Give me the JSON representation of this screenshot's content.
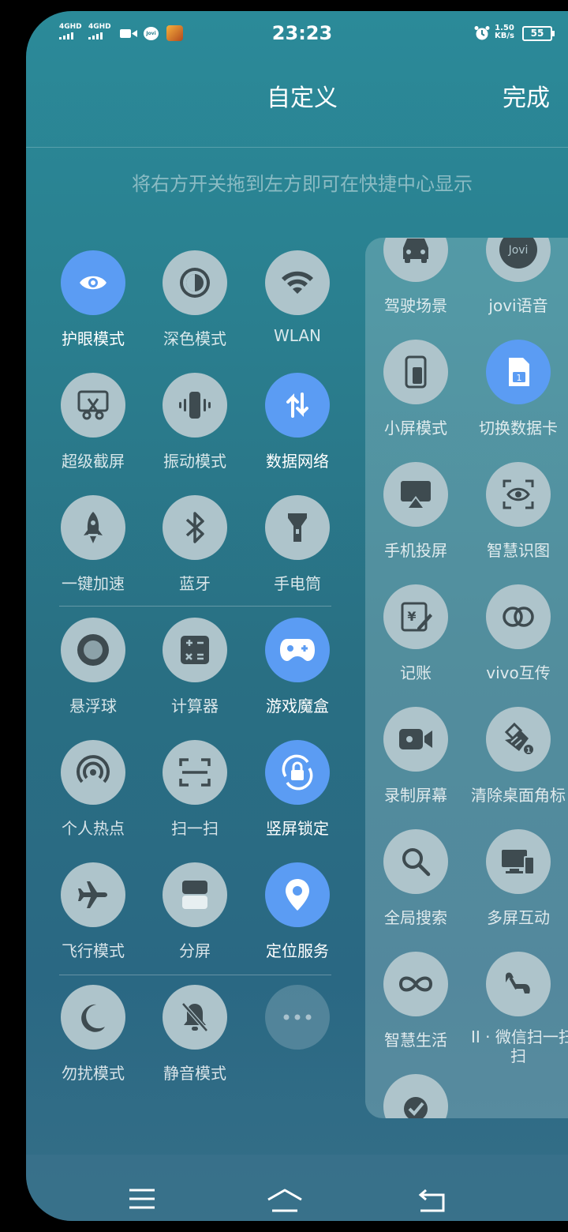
{
  "status": {
    "signal1": "4GHD",
    "signal2": "4GHD",
    "jovi_badge": "Jovi",
    "time": "23:23",
    "speed_value": "1.50",
    "speed_unit": "KB/s",
    "battery": "55"
  },
  "header": {
    "title": "自定义",
    "done": "完成"
  },
  "hint": "将右方开关拖到左方即可在快捷中心显示",
  "active_tiles": [
    {
      "label": "护眼模式",
      "icon": "eye-icon",
      "on": true
    },
    {
      "label": "深色模式",
      "icon": "dark-mode-icon",
      "on": false
    },
    {
      "label": "WLAN",
      "icon": "wifi-icon",
      "on": false
    },
    {
      "label": "超级截屏",
      "icon": "screenshot-icon",
      "on": false
    },
    {
      "label": "振动模式",
      "icon": "vibrate-icon",
      "on": false
    },
    {
      "label": "数据网络",
      "icon": "data-network-icon",
      "on": true
    },
    {
      "label": "一键加速",
      "icon": "rocket-icon",
      "on": false
    },
    {
      "label": "蓝牙",
      "icon": "bluetooth-icon",
      "on": false
    },
    {
      "label": "手电筒",
      "icon": "flashlight-icon",
      "on": false
    },
    {
      "label": "悬浮球",
      "icon": "floating-ball-icon",
      "on": false
    },
    {
      "label": "计算器",
      "icon": "calculator-icon",
      "on": false
    },
    {
      "label": "游戏魔盒",
      "icon": "gamepad-icon",
      "on": true
    },
    {
      "label": "个人热点",
      "icon": "hotspot-icon",
      "on": false
    },
    {
      "label": "扫一扫",
      "icon": "scan-icon",
      "on": false
    },
    {
      "label": "竖屏锁定",
      "icon": "rotation-lock-icon",
      "on": true
    },
    {
      "label": "飞行模式",
      "icon": "airplane-icon",
      "on": false
    },
    {
      "label": "分屏",
      "icon": "split-screen-icon",
      "on": false
    },
    {
      "label": "定位服务",
      "icon": "location-icon",
      "on": true
    },
    {
      "label": "勿扰模式",
      "icon": "moon-icon",
      "on": false
    },
    {
      "label": "静音模式",
      "icon": "bell-off-icon",
      "on": false
    }
  ],
  "more_tile": {
    "icon": "more-dots-icon"
  },
  "available_tiles": [
    {
      "label": "驾驶场景",
      "icon": "car-icon",
      "on": false
    },
    {
      "label": "jovi语音",
      "icon": "jovi-icon",
      "on": false,
      "badge": "Jovi"
    },
    {
      "label": "小屏模式",
      "icon": "small-screen-icon",
      "on": false
    },
    {
      "label": "切换数据卡",
      "icon": "sim-card-icon",
      "on": true,
      "badge": "1"
    },
    {
      "label": "手机投屏",
      "icon": "cast-icon",
      "on": false
    },
    {
      "label": "智慧识图",
      "icon": "smart-vision-icon",
      "on": false
    },
    {
      "label": "记账",
      "icon": "bookkeeping-icon",
      "on": false,
      "badge": "¥"
    },
    {
      "label": "vivo互传",
      "icon": "vivo-share-icon",
      "on": false
    },
    {
      "label": "录制屏幕",
      "icon": "screen-record-icon",
      "on": false
    },
    {
      "label": "清除桌面角标",
      "icon": "clear-badge-icon",
      "on": false,
      "badge": "1"
    },
    {
      "label": "全局搜索",
      "icon": "search-icon",
      "on": false
    },
    {
      "label": "多屏互动",
      "icon": "multi-screen-icon",
      "on": false
    },
    {
      "label": "智慧生活",
      "icon": "smart-life-icon",
      "on": false
    },
    {
      "label": "II · 微信扫一扫",
      "label2": "扫",
      "icon": "wechat-scan-icon",
      "on": false
    },
    {
      "label": "",
      "icon": "check-bubble-icon",
      "on": false
    }
  ],
  "colors": {
    "active": "#5b9cf3",
    "inactive": "#aec4cb",
    "background": "#2a7f8f"
  },
  "nav": {
    "menu": "menu-icon",
    "home": "home-icon",
    "back": "back-icon"
  }
}
